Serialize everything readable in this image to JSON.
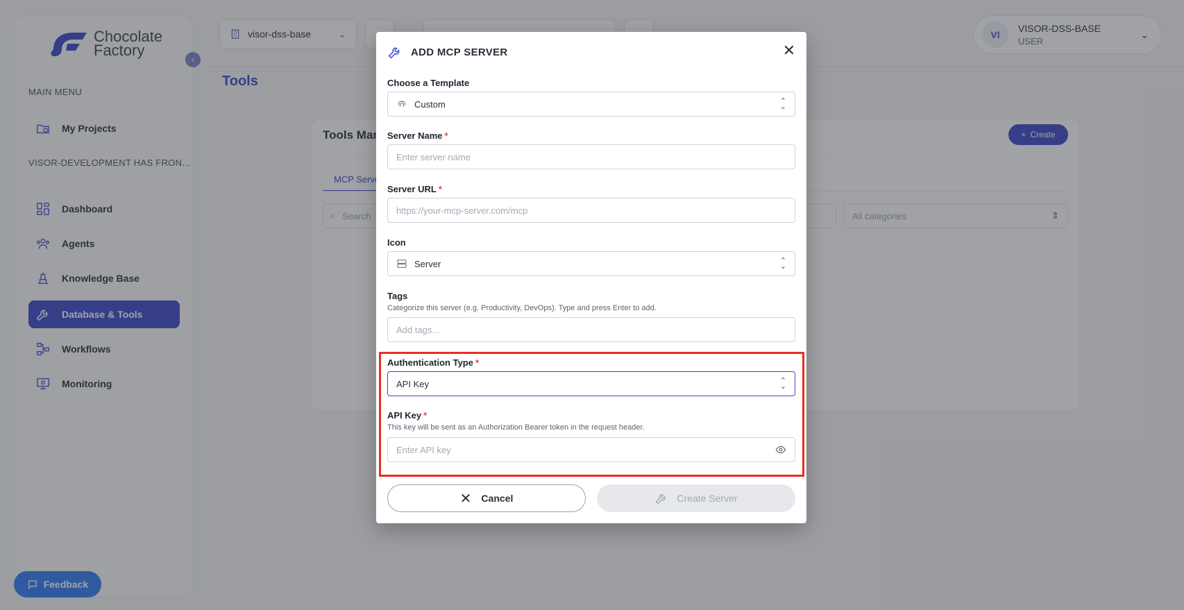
{
  "brand": {
    "line1": "Chocolate",
    "line2": "Factory"
  },
  "sidebar": {
    "collapse_glyph": "‹",
    "main_menu_heading": "MAIN MENU",
    "main_items": [
      {
        "label": "My Projects",
        "icon": "projects-icon"
      }
    ],
    "workspace_heading": "VISOR-DEVELOPMENT HAS FRON...",
    "items": [
      {
        "label": "Dashboard",
        "icon": "dashboard-icon"
      },
      {
        "label": "Agents",
        "icon": "agents-icon"
      },
      {
        "label": "Knowledge Base",
        "icon": "knowledge-base-icon"
      },
      {
        "label": "Database & Tools",
        "icon": "wrench-icon",
        "active": true
      },
      {
        "label": "Workflows",
        "icon": "workflows-icon"
      },
      {
        "label": "Monitoring",
        "icon": "monitoring-icon"
      }
    ],
    "feedback_label": "Feedback"
  },
  "topbar": {
    "workspace": "visor-dss-base",
    "user": {
      "initials": "VI",
      "name": "VISOR-DSS-BASE",
      "role": "USER"
    }
  },
  "page": {
    "title": "Tools",
    "card_title": "Tools Man",
    "create_label": "Create",
    "tab_label": "MCP Serve",
    "search_placeholder": "Search",
    "category_placeholder": "All categories"
  },
  "modal": {
    "title": "ADD MCP SERVER",
    "close_glyph": "✕",
    "template": {
      "label": "Choose a Template",
      "value": "Custom"
    },
    "server_name": {
      "label": "Server Name",
      "placeholder": "Enter server name"
    },
    "server_url": {
      "label": "Server URL",
      "placeholder": "https://your-mcp-server.com/mcp"
    },
    "icon_field": {
      "label": "Icon",
      "value": "Server"
    },
    "tags": {
      "label": "Tags",
      "help": "Categorize this server (e.g. Productivity, DevOps). Type and press Enter to add.",
      "placeholder": "Add tags..."
    },
    "auth_type": {
      "label": "Authentication Type",
      "value": "API Key"
    },
    "api_key": {
      "label": "API Key",
      "help": "This key will be sent as an Authorization Bearer token in the request header.",
      "placeholder": "Enter API key"
    },
    "cancel_label": "Cancel",
    "create_label": "Create Server",
    "required_mark": "*"
  },
  "colors": {
    "accent": "#3a47c9",
    "highlight": "#ec2d1f",
    "required": "#e04a3c",
    "feedback": "#2f7bf6"
  }
}
